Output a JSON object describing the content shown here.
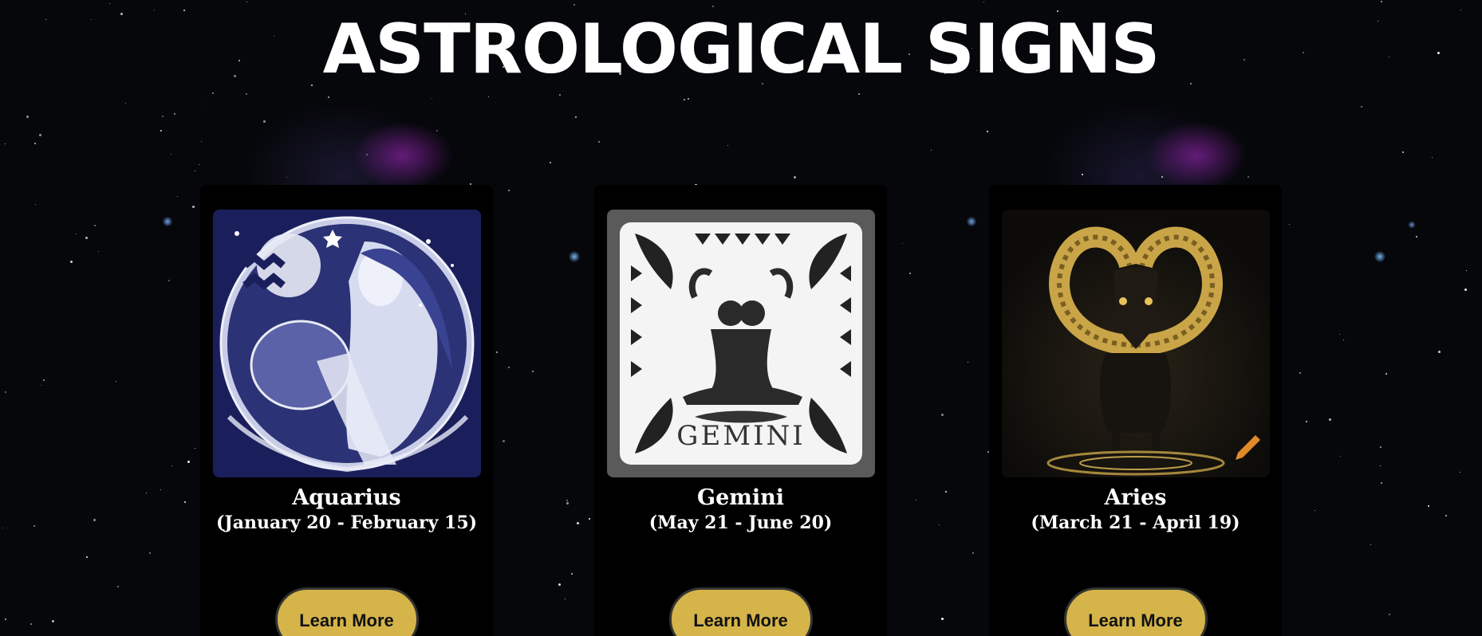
{
  "page": {
    "title": "ASTROLOGICAL SIGNS"
  },
  "cards": [
    {
      "name": "Aquarius",
      "dates": "(January 20 - February 15)",
      "button_label": "Learn More",
      "image_icon": "aquarius-water-bearer-illustration"
    },
    {
      "name": "Gemini",
      "dates": "(May 21 - June 20)",
      "button_label": "Learn More",
      "image_icon": "gemini-twins-illustration",
      "image_text": "GEMINI"
    },
    {
      "name": "Aries",
      "dates": "(March 21 - April 19)",
      "button_label": "Learn More",
      "image_icon": "aries-ram-illustration"
    }
  ],
  "colors": {
    "background": "#06070b",
    "card": "#000000",
    "button": "#d5b44a",
    "button_border": "#333333",
    "text": "#ffffff"
  }
}
